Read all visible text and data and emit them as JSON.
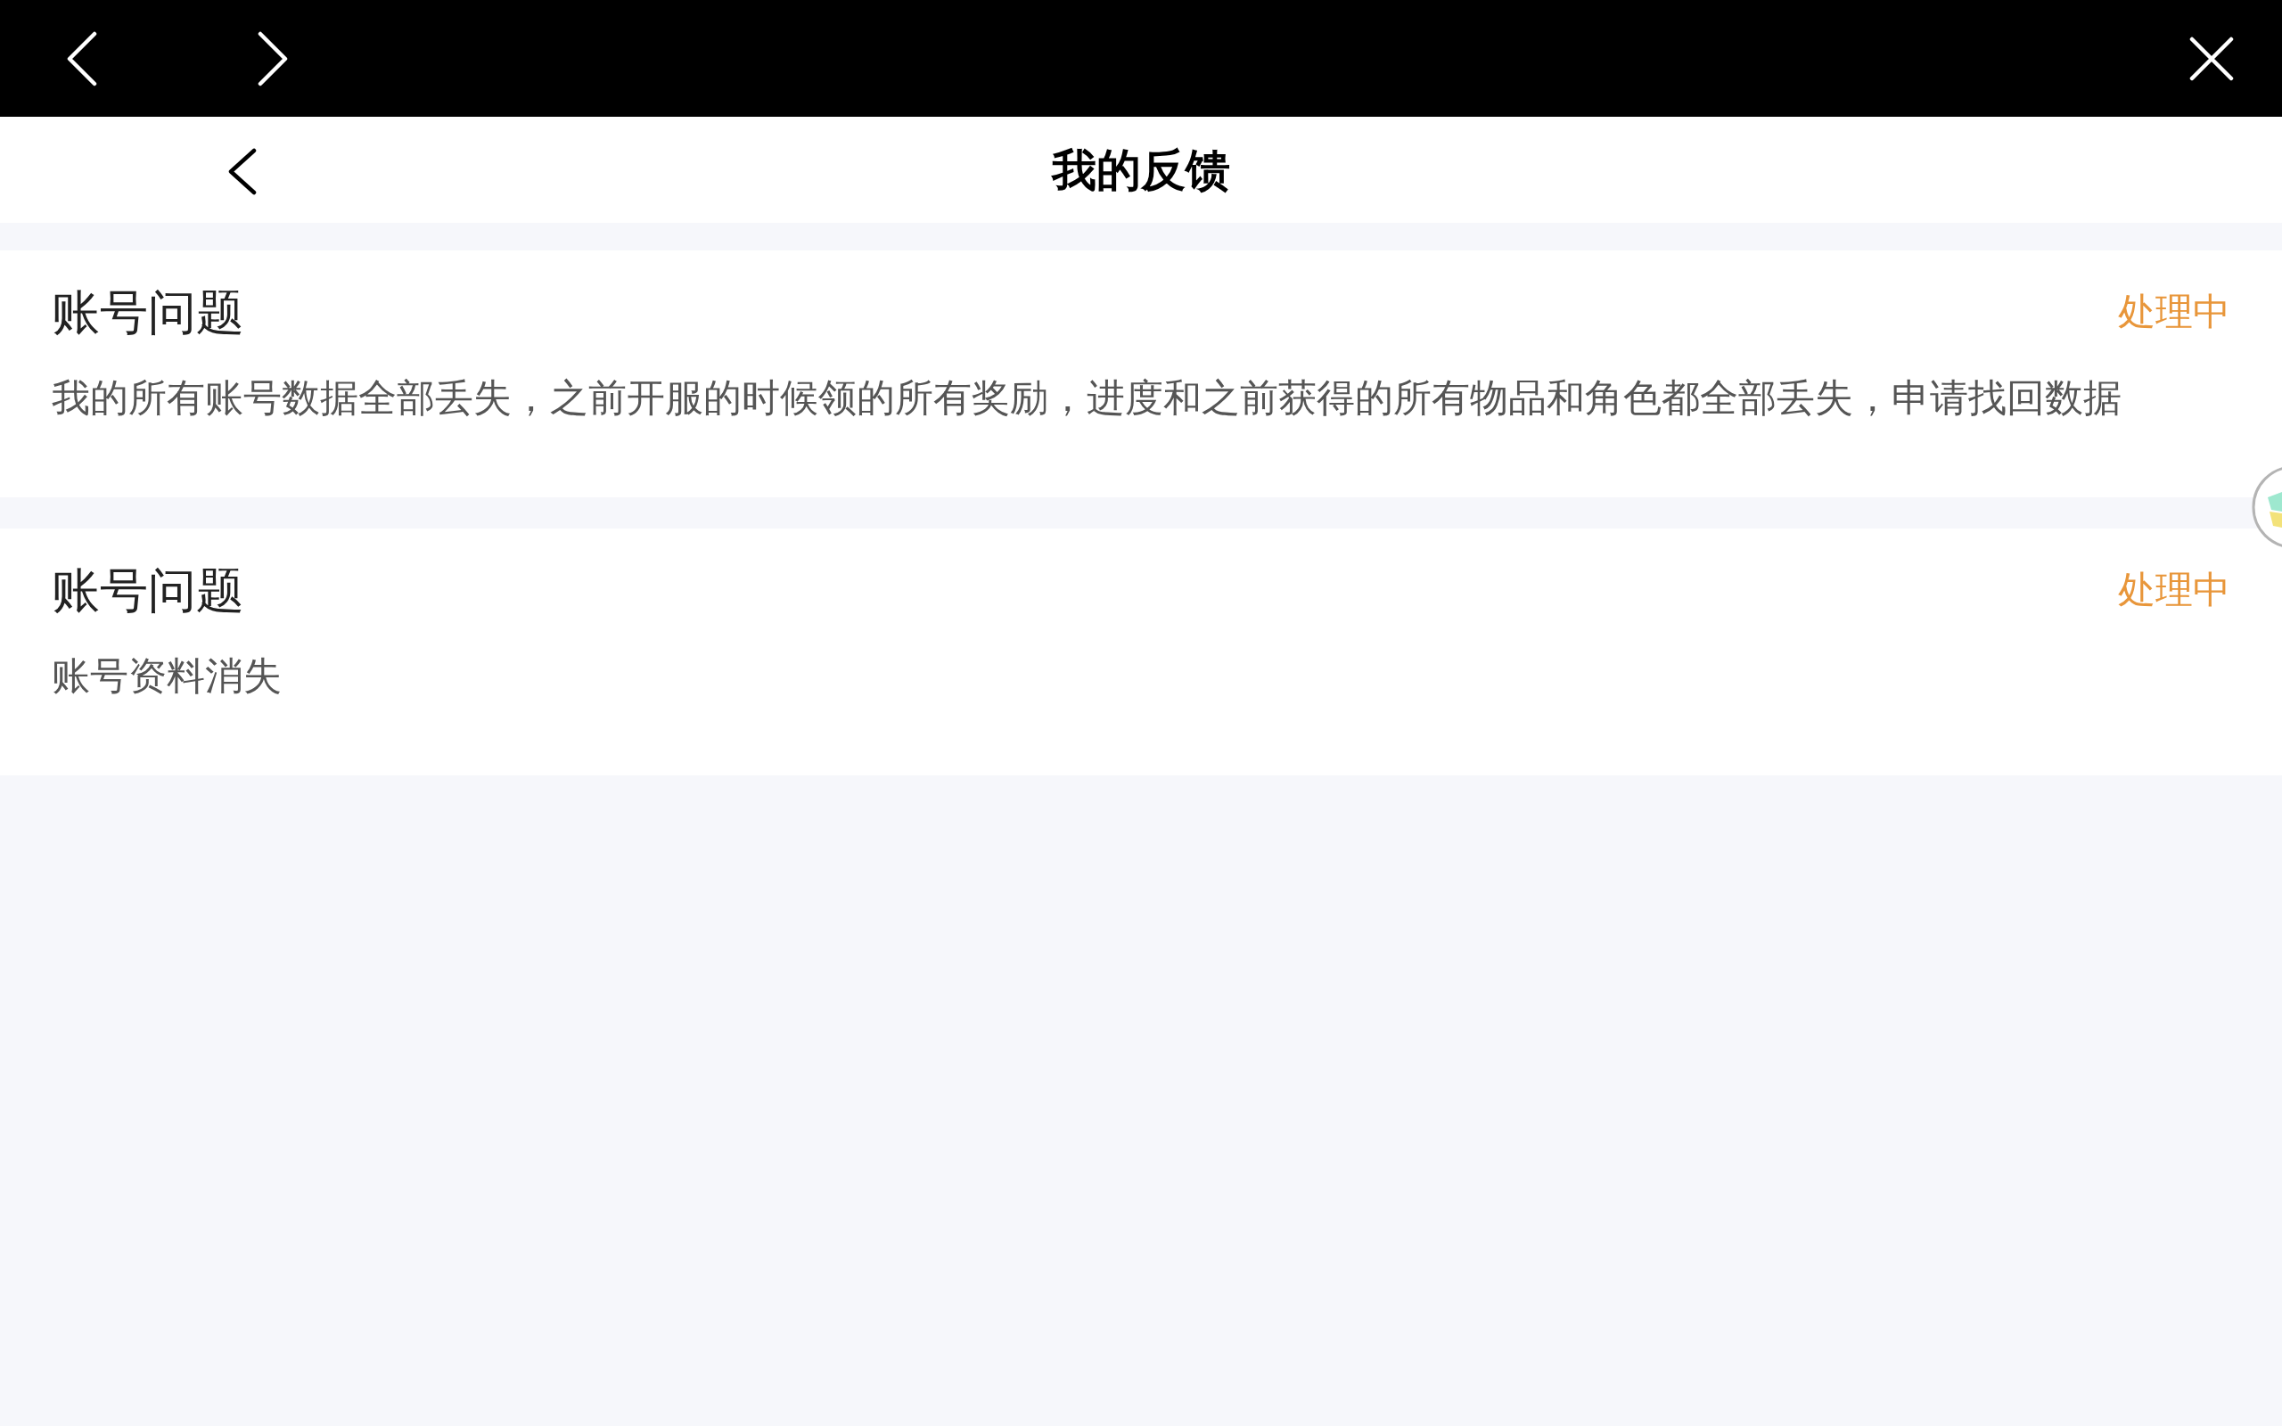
{
  "header": {
    "title": "我的反馈"
  },
  "feedback_items": [
    {
      "category": "账号问题",
      "status": "处理中",
      "description": "我的所有账号数据全部丢失，之前开服的时候领的所有奖励，进度和之前获得的所有物品和角色都全部丢失，申请找回数据"
    },
    {
      "category": "账号问题",
      "status": "处理中",
      "description": "账号资料消失"
    }
  ]
}
